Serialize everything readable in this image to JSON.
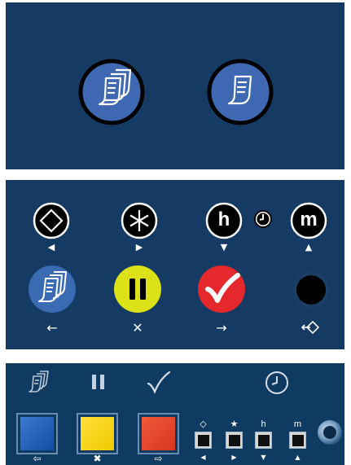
{
  "panel_top": {
    "buttons": [
      {
        "name": "multi-document-button",
        "icon": "multi-document-icon"
      },
      {
        "name": "single-document-button",
        "icon": "single-document-icon"
      }
    ]
  },
  "panel_mid": {
    "top_row": [
      {
        "name": "diamond-button",
        "letter": "",
        "caption": "◀"
      },
      {
        "name": "asterisk-button",
        "letter": "",
        "caption": "▶"
      },
      {
        "name": "h-button",
        "letter": "h",
        "caption": "▼"
      },
      {
        "name": "m-button",
        "letter": "m",
        "caption": "▲"
      }
    ],
    "bottom_row": [
      {
        "name": "documents-button",
        "caption": "←",
        "color": "#3a6bb3"
      },
      {
        "name": "pause-button",
        "caption": "✕",
        "color": "#dde218"
      },
      {
        "name": "confirm-button",
        "caption": "→",
        "color": "#e4282c"
      },
      {
        "name": "black-round-button",
        "caption": "",
        "color": "#000000"
      }
    ]
  },
  "panel_bottom": {
    "big_buttons": [
      {
        "name": "blue-square-button",
        "color": "#1d58b8",
        "caption": "⇦"
      },
      {
        "name": "yellow-square-button",
        "color": "#f5d000",
        "caption": "✖"
      },
      {
        "name": "red-square-button",
        "color": "#e2442b",
        "caption": "⇨"
      }
    ],
    "small_buttons": [
      {
        "name": "diamond-small-button",
        "label": "◇",
        "caption": "◀"
      },
      {
        "name": "star-small-button",
        "label": "★",
        "caption": "▶"
      },
      {
        "name": "h-small-button",
        "label": "h",
        "caption": "▼"
      },
      {
        "name": "m-small-button",
        "label": "m",
        "caption": "▲"
      }
    ]
  }
}
